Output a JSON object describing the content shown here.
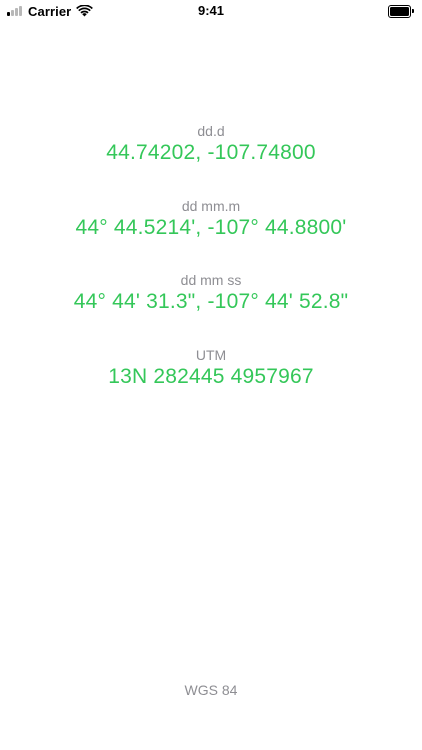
{
  "status_bar": {
    "carrier": "Carrier",
    "time": "9:41",
    "signal_bars_active": 1,
    "signal_bars_total": 4,
    "battery_level": 1.0,
    "icons": [
      "signal-icon",
      "wifi-icon",
      "battery-icon"
    ]
  },
  "coordinates": {
    "dd": {
      "label": "dd.d",
      "value": "44.74202, -107.74800"
    },
    "ddm": {
      "label": "dd mm.m",
      "value": "44° 44.5214', -107° 44.8800'"
    },
    "dms": {
      "label": "dd mm ss",
      "value": "44° 44' 31.3\", -107° 44' 52.8\""
    },
    "utm": {
      "label": "UTM",
      "value": "13N 282445 4957967"
    }
  },
  "datum": "WGS 84",
  "colors": {
    "value_text": "#34c759",
    "label_text": "#8e8e93",
    "background": "#ffffff"
  }
}
